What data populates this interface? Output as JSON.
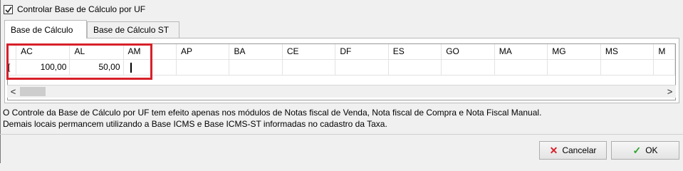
{
  "form": {
    "control_checkbox": {
      "label": "Controlar Base de Cálculo por UF",
      "checked": true
    }
  },
  "tabs": [
    {
      "label": "Base de Cálculo",
      "active": true
    },
    {
      "label": "Base de Cálculo ST",
      "active": false
    }
  ],
  "grid": {
    "columns": [
      "AC",
      "AL",
      "AM",
      "AP",
      "BA",
      "CE",
      "DF",
      "ES",
      "GO",
      "MA",
      "MG",
      "MS",
      "M"
    ],
    "rows": [
      {
        "row_marker": "[",
        "values": [
          "100,00",
          "50,00",
          "",
          "",
          "",
          "",
          "",
          "",
          "",
          "",
          "",
          "",
          ""
        ]
      }
    ]
  },
  "scrollbar": {
    "left_arrow": "<",
    "right_arrow": ">"
  },
  "info_text": {
    "line1": "O Controle da Base de Cálculo por UF tem efeito apenas nos módulos de Notas fiscal de Venda, Nota fiscal de Compra e Nota Fiscal Manual.",
    "line2": "Demais locais permancem utilizando a Base ICMS e Base ICMS-ST informadas no cadastro da Taxa."
  },
  "buttons": {
    "cancel_label": "Cancelar",
    "ok_label": "OK"
  },
  "icons": {
    "cancel": "x-icon",
    "ok": "checkmark-icon"
  },
  "colors": {
    "highlight": "#d7202a",
    "cancel_icon": "#d7202a",
    "ok_icon": "#2ea32e"
  }
}
